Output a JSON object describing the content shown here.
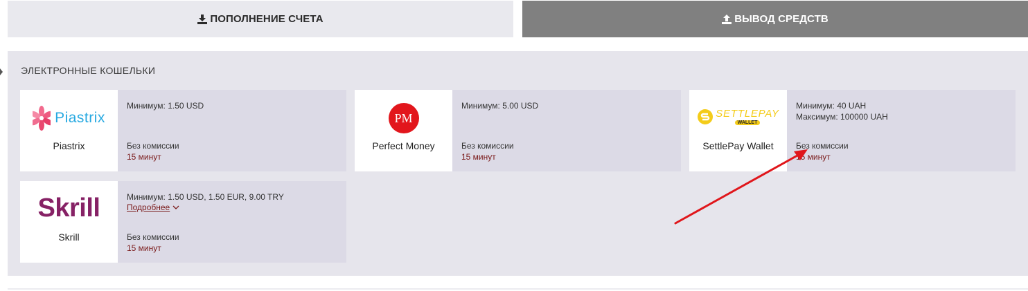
{
  "tabs": {
    "deposit_label": "ПОПОЛНЕНИЕ СЧЕТА",
    "withdraw_label": "ВЫВОД СРЕДСТВ"
  },
  "section": {
    "title": "ЭЛЕКТРОННЫЕ КОШЕЛЬКИ"
  },
  "cards": [
    {
      "name": "Piastrix",
      "logo_text": "Piastrix",
      "min": "Минимум: 1.50 USD",
      "max": "",
      "fee": "Без комиссии",
      "time": "15 минут"
    },
    {
      "name": "Perfect Money",
      "logo_text": "PM",
      "min": "Минимум: 5.00 USD",
      "max": "",
      "fee": "Без комиссии",
      "time": "15 минут"
    },
    {
      "name": "SettlePay Wallet",
      "logo_text": "SETTLEPAY",
      "logo_sub": "WALLET",
      "min": "Минимум: 40 UAH",
      "max": "Максимум: 100000 UAH",
      "fee": "Без комиссии",
      "time": "15 минут"
    },
    {
      "name": "Skrill",
      "logo_text": "Skrill",
      "min": "Минимум: 1.50 USD, 1.50 EUR, 9.00 TRY",
      "more": "Подробнее",
      "fee": "Без комиссии",
      "time": "15 минут"
    }
  ],
  "colors": {
    "accent_dark_red": "#7a1a1a",
    "active_tab": "#808080",
    "annotation_arrow": "#e0161b",
    "settlepay_yellow": "#f4cc1a",
    "skrill_purple": "#862165",
    "pm_red": "#e2161c"
  },
  "icons": {
    "deposit": "download-icon",
    "withdraw": "upload-icon",
    "more": "chevron-down-icon"
  }
}
